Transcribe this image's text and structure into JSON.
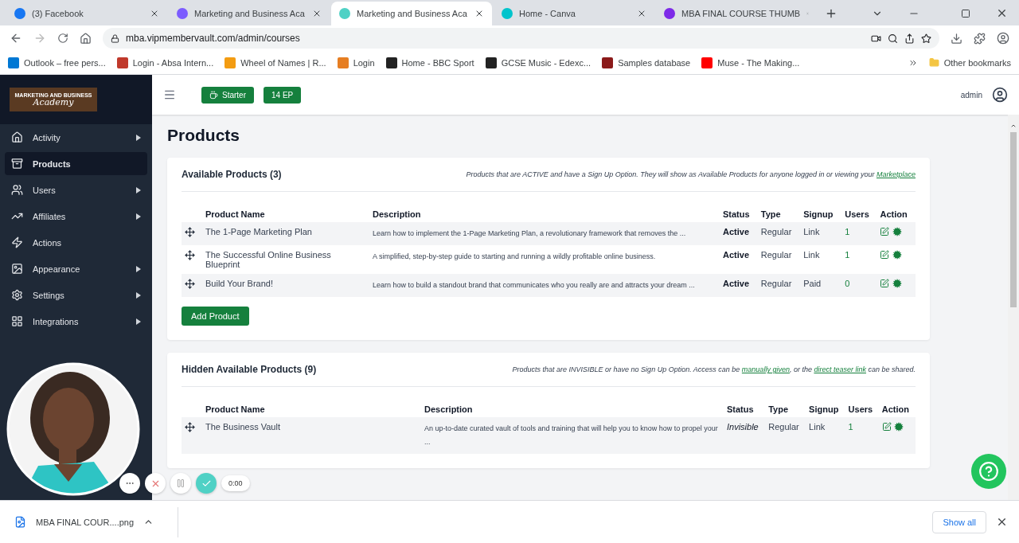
{
  "browser": {
    "tabs": [
      {
        "title": "(3) Facebook",
        "selected": false
      },
      {
        "title": "Marketing and Business Aca",
        "selected": false
      },
      {
        "title": "Marketing and Business Aca",
        "selected": true
      },
      {
        "title": "Home - Canva",
        "selected": false
      },
      {
        "title": "MBA FINAL COURSE THUMB",
        "selected": false
      }
    ],
    "url": "mba.vipmembervault.com/admin/courses",
    "bookmarks": [
      "Outlook – free pers...",
      "Login - Absa Intern...",
      "Wheel of Names | R...",
      "Login",
      "Home - BBC Sport",
      "GCSE Music - Edexc...",
      "Samples database",
      "Muse - The Making..."
    ],
    "other_bookmarks": "Other bookmarks"
  },
  "sidebar": {
    "logo_top": "MARKETING AND BUSINESS",
    "logo_script": "Academy",
    "items": [
      {
        "label": "Activity",
        "selected": false,
        "expandable": true
      },
      {
        "label": "Products",
        "selected": true,
        "expandable": false
      },
      {
        "label": "Users",
        "selected": false,
        "expandable": true
      },
      {
        "label": "Affiliates",
        "selected": false,
        "expandable": true
      },
      {
        "label": "Actions",
        "selected": false,
        "expandable": false
      },
      {
        "label": "Appearance",
        "selected": false,
        "expandable": true
      },
      {
        "label": "Settings",
        "selected": false,
        "expandable": true
      },
      {
        "label": "Integrations",
        "selected": false,
        "expandable": true
      }
    ]
  },
  "topbar": {
    "badges": [
      "Starter",
      "14 EP"
    ],
    "user": "admin"
  },
  "title": "Products",
  "sections": [
    {
      "title": "Available Products (3)",
      "note": [
        {
          "text": "Products that are ACTIVE and have a Sign Up Option. They will show as Available Products for anyone logged in or viewing your ",
          "link": false
        },
        {
          "text": "Marketplace",
          "link": true
        }
      ],
      "columns": [
        "Product Name",
        "Description",
        "Status",
        "Type",
        "Signup",
        "Users",
        "Action"
      ],
      "rows": [
        {
          "name": "The 1-Page Marketing Plan",
          "description": "Learn how to implement the 1-Page Marketing Plan, a revolutionary framework that removes the ...",
          "status": "Active",
          "kind": "active",
          "type": "Regular",
          "signup": "Link",
          "users": "1"
        },
        {
          "name": "The Successful Online Business Blueprint",
          "description": "A simplified, step-by-step guide to starting and running a wildly profitable online business.",
          "status": "Active",
          "kind": "active",
          "type": "Regular",
          "signup": "Link",
          "users": "1"
        },
        {
          "name": "Build Your Brand!",
          "description": "Learn how to build a standout brand that communicates who you really are and attracts your dream ...",
          "status": "Active",
          "kind": "active",
          "type": "Regular",
          "signup": "Paid",
          "users": "0"
        }
      ],
      "add_button": "Add Product"
    },
    {
      "title": "Hidden Available Products (9)",
      "note": [
        {
          "text": "Products that are INVISIBLE or have no Sign Up Option. Access can be ",
          "link": false
        },
        {
          "text": "manually given",
          "link": true
        },
        {
          "text": ", or the ",
          "link": false
        },
        {
          "text": "direct teaser link",
          "link": true
        },
        {
          "text": " can be shared.",
          "link": false
        }
      ],
      "columns": [
        "Product Name",
        "Description",
        "Status",
        "Type",
        "Signup",
        "Users",
        "Action"
      ],
      "rows": [
        {
          "name": "The Business Vault",
          "description": "An up-to-date curated vault of tools and training that will help you to know how to propel your ...",
          "status": "Invisible",
          "kind": "hidden",
          "type": "Regular",
          "signup": "Link",
          "users": "1"
        }
      ]
    }
  ],
  "recorder": {
    "timer": "0:00"
  },
  "downloads": {
    "file": "MBA FINAL COUR....png",
    "show_all": "Show all"
  }
}
